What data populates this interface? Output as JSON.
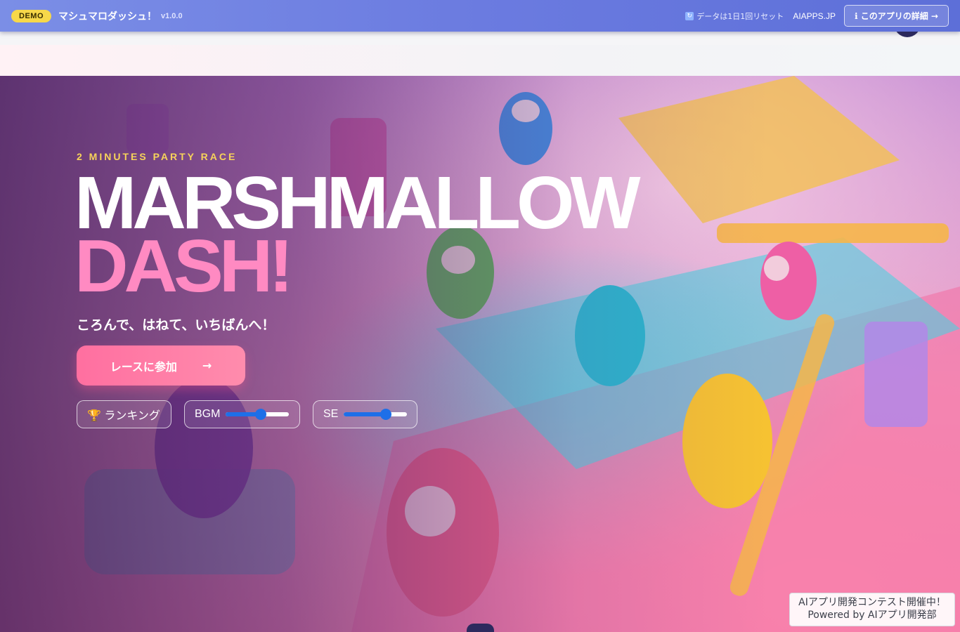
{
  "topbar": {
    "badge": "DEMO",
    "app_title": "マシュマロダッシュ！",
    "version": "v1.0.0",
    "reset_note": "データは1日1回リセット",
    "reset_icon": "refresh-icon",
    "site_link": "AIAPPS.JP",
    "details_button": "ℹ このアプリの詳細 →"
  },
  "hero": {
    "eyebrow": "2 MINUTES PARTY RACE",
    "title_line1": "MARSHMALLOW",
    "title_line2": "DASH!",
    "tagline": "ころんで、はねて、いちばんへ！",
    "cta_label": "レースに参加",
    "cta_arrow": "→",
    "ranking_label": "🏆 ランキング",
    "bgm_label": "BGM",
    "bgm_level": 0.55,
    "se_label": "SE",
    "se_level": 0.67
  },
  "footer": {
    "contest_line1": "AIアプリ開発コンテスト開催中！",
    "contest_line2": "Powered by AIアプリ開発部"
  },
  "colors": {
    "accent_pink": "#ff8ac2",
    "eyebrow_yellow": "#f7d35a",
    "topbar": "#6b7be0",
    "slider_blue": "#1e6fe8"
  }
}
